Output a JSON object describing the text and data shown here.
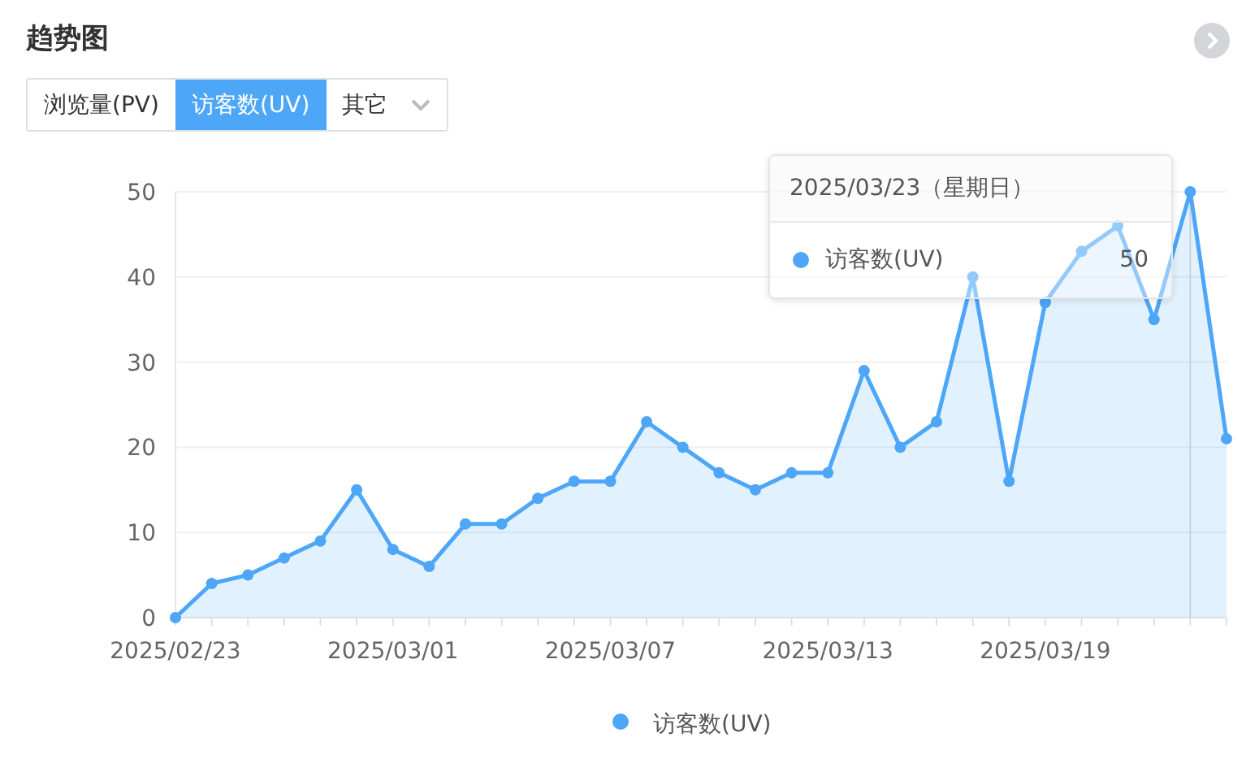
{
  "title": "趋势图",
  "tabs": [
    {
      "label": "浏览量(PV)",
      "kind": "tab",
      "selected": false
    },
    {
      "label": "访客数(UV)",
      "kind": "tab",
      "selected": true
    },
    {
      "label": "其它",
      "kind": "dropdown",
      "selected": false
    }
  ],
  "chart": {
    "chart_data": {
      "type": "area",
      "categories": [
        "2025/02/23",
        null,
        null,
        null,
        null,
        null,
        "2025/03/01",
        null,
        null,
        null,
        null,
        null,
        "2025/03/07",
        null,
        null,
        null,
        null,
        null,
        "2025/03/13",
        null,
        null,
        null,
        null,
        null,
        "2025/03/19",
        null,
        null,
        null,
        null,
        null
      ],
      "ylim": [
        0,
        50
      ],
      "grid": true,
      "yticks": [
        0,
        10,
        20,
        30,
        40,
        50
      ],
      "series": [
        {
          "name": "访客数(UV)",
          "color": "#4da6f8",
          "values": [
            0,
            4,
            5,
            7,
            9,
            15,
            8,
            6,
            11,
            11,
            14,
            16,
            16,
            23,
            20,
            17,
            15,
            17,
            17,
            29,
            20,
            23,
            40,
            16,
            37,
            43,
            46,
            35,
            50,
            21
          ]
        }
      ]
    },
    "tooltip": {
      "title": "2025/03/23（星期日）",
      "label": "访客数(UV)",
      "value": "50"
    }
  }
}
